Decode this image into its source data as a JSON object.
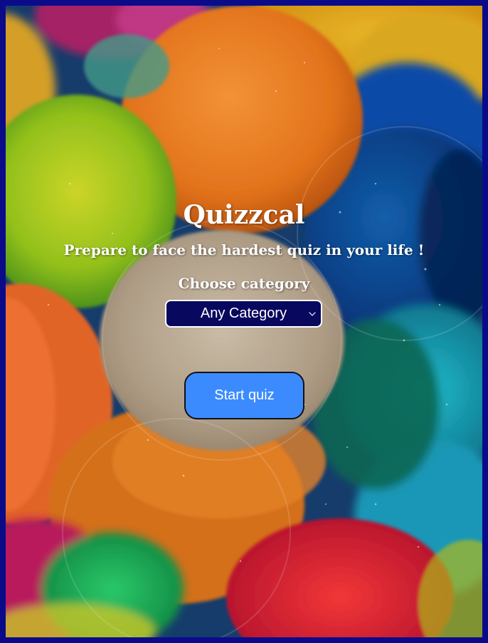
{
  "app": {
    "title": "Quizzcal",
    "tagline": "Prepare to face the hardest quiz in your life !"
  },
  "category": {
    "label": "Choose category",
    "selected": "Any Category"
  },
  "actions": {
    "start_label": "Start quiz"
  },
  "theme": {
    "frame_border": "#0b0b8a",
    "select_bg": "#08085e",
    "button_bg": "#3b8bff",
    "text": "#ffffff"
  },
  "icons": {
    "select_arrow": "chevron-down-icon"
  }
}
